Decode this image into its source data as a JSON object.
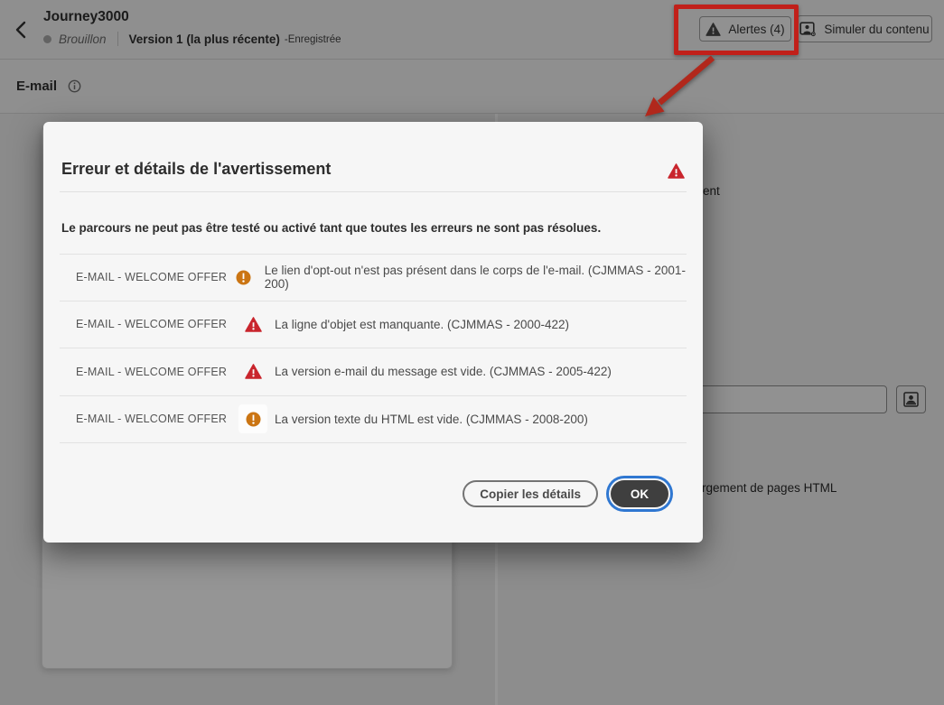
{
  "header": {
    "title": "Journey3000",
    "status": "Brouillon",
    "version": "Version 1 (la plus récente)",
    "saved": "-Enregistrée",
    "alerts_button": "Alertes (4)",
    "simulate_button": "Simuler du contenu"
  },
  "toolbar": {
    "channel_label": "E-mail"
  },
  "background": {
    "partial_text_top": "ent",
    "partial_text_bottom": "rgement de pages HTML"
  },
  "modal": {
    "title": "Erreur et détails de l'avertissement",
    "message": "Le parcours ne peut pas être testé ou activé tant que toutes les erreurs ne sont pas résolues.",
    "rows": [
      {
        "source": "E-MAIL - WELCOME OFFER",
        "severity": "warning",
        "text": "Le lien d'opt-out n'est pas présent dans le corps de l'e-mail. (CJMMAS - 2001-200)"
      },
      {
        "source": "E-MAIL - WELCOME OFFER",
        "severity": "error",
        "text": "La ligne d'objet est manquante. (CJMMAS - 2000-422)"
      },
      {
        "source": "E-MAIL - WELCOME OFFER",
        "severity": "error",
        "text": "La version e-mail du message est vide. (CJMMAS - 2005-422)"
      },
      {
        "source": "E-MAIL - WELCOME OFFER",
        "severity": "warning",
        "text": "La version texte du HTML est vide. (CJMMAS - 2008-200)"
      }
    ],
    "copy_button": "Copier les détails",
    "ok_button": "OK"
  },
  "colors": {
    "error": "#c9252d",
    "warning": "#cb7513",
    "annotation_red": "#c1201a",
    "focus_ring_blue": "#2f77d1"
  }
}
